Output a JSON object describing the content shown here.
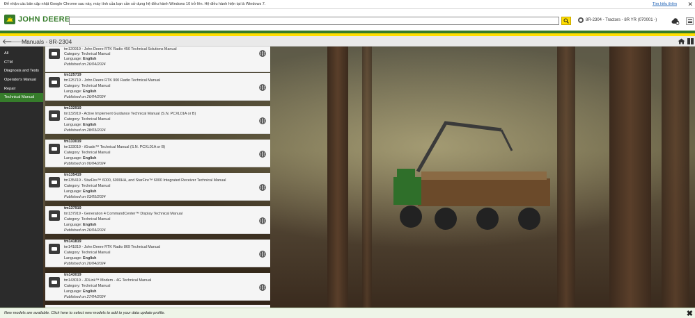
{
  "notice": {
    "message": "Để nhận các bản cập nhật Google Chrome sau này, máy tính của bạn cần sử dụng hệ điều hành Windows 10 trở lên. Hệ điều hành hiện tại là Windows 7.",
    "learn_more": "Tìm hiểu thêm",
    "close": "✕"
  },
  "header": {
    "brand": "JOHN DEERE",
    "search_placeholder": "",
    "model_label": "8R-2304 - Tractors - 8R YR (070001 -)"
  },
  "navbar": {
    "title": "Manuals - 8R-2304"
  },
  "sidebar": {
    "items": [
      {
        "label": "All"
      },
      {
        "label": "CTM"
      },
      {
        "label": "Diagnosis and Tests"
      },
      {
        "label": "Operator's Manual"
      },
      {
        "label": "Repair"
      },
      {
        "label": "Technical Manual"
      }
    ]
  },
  "results": [
    {
      "code": "",
      "title": "tm120919 - John Deere RTK Radio 450 Technical Solutions Manual",
      "category": "Category: Technical Manual",
      "language_label": "Language:",
      "language": "English",
      "published": "Published on 26/04/2024"
    },
    {
      "code": "tm125719",
      "title": "tm125719 - John Deere RTK 900 Radio Technical Manual",
      "category": "Category: Technical Manual",
      "language_label": "Language:",
      "language": "English",
      "published": "Published on 26/04/2024"
    },
    {
      "code": "tm132919",
      "title": "tm132919 - Active Implement Guidance Technical Manual (S.N. PCXL01A or B)",
      "category": "Category: Technical Manual",
      "language_label": "Language:",
      "language": "English",
      "published": "Published on 28/03/2024"
    },
    {
      "code": "tm133019",
      "title": "tm133019 - iGrade™ Technical Manual (S.N. PCXL01A or B)",
      "category": "Category: Technical Manual",
      "language_label": "Language:",
      "language": "English",
      "published": "Published on 06/04/2024"
    },
    {
      "code": "tm135419",
      "title": "tm135419 - StarFire™ 6000, 6000HA, and StarFire™ 6000 Integrated Receiver Technical Manual",
      "category": "Category: Technical Manual",
      "language_label": "Language:",
      "language": "English",
      "published": "Published on 03/05/2024"
    },
    {
      "code": "tm137919",
      "title": "tm137919 - Generation 4 CommandCenter™ Display Technical Manual",
      "category": "Category: Technical Manual",
      "language_label": "Language:",
      "language": "English",
      "published": "Published on 26/04/2024"
    },
    {
      "code": "tm141819",
      "title": "tm141819 - John Deere RTK Radio 869 Technical Manual",
      "category": "Category: Technical Manual",
      "language_label": "Language:",
      "language": "English",
      "published": "Published on 26/04/2024"
    },
    {
      "code": "tm143019",
      "title": "tm143019 - JDLink™ Modem - 4G Technical Manual",
      "category": "Category: Technical Manual",
      "language_label": "Language:",
      "language": "English",
      "published": "Published on 27/04/2024"
    }
  ],
  "footer": {
    "message": "New models are available. Click here to select new models to add to your data update profile.",
    "close": "✖"
  },
  "colors": {
    "brand_green": "#367c2b",
    "brand_yellow": "#ffde00",
    "sidebar_bg": "#2b2b2b"
  },
  "icons": [
    "john-deere-logo-icon",
    "search-icon",
    "model-selector-icon",
    "cloud-sync-icon",
    "hamburger-menu-icon",
    "back-arrow-icon",
    "forward-arrow-icon",
    "home-icon",
    "split-view-icon",
    "document-icon",
    "globe-icon"
  ]
}
